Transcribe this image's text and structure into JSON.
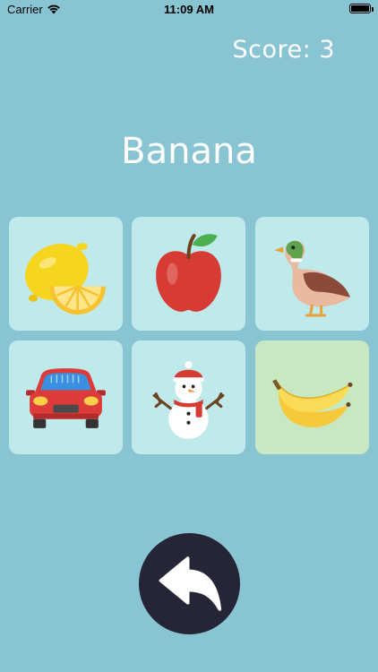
{
  "status_bar": {
    "carrier": "Carrier",
    "time": "11:09 AM"
  },
  "game": {
    "score_text": "Score: 3",
    "target_word": "Banana",
    "choices": [
      {
        "item": "lemon",
        "icon": "lemon-icon"
      },
      {
        "item": "apple",
        "icon": "apple-icon"
      },
      {
        "item": "duck",
        "icon": "duck-icon"
      },
      {
        "item": "car",
        "icon": "car-icon"
      },
      {
        "item": "snowman",
        "icon": "snowman-icon"
      },
      {
        "item": "banana",
        "icon": "banana-icon",
        "highlighted": true
      }
    ]
  },
  "controls": {
    "back_icon": "back-arrow-icon"
  },
  "colors": {
    "background": "#89c4d2",
    "card": "#c0e9ec",
    "card_correct": "#c8e8c2",
    "back_button": "#262437"
  }
}
